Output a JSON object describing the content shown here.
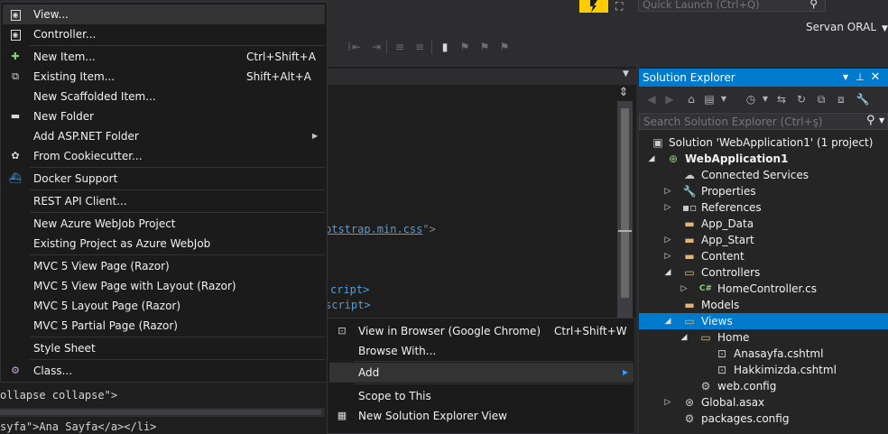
{
  "quick_launch": {
    "placeholder": "Quick Launch (Ctrl+Q)"
  },
  "user": {
    "name": "Servan ORAL"
  },
  "editor": {
    "code_fragments": {
      "css_link": "otstrap.min.css",
      "css_link_end": "\">",
      "script_close_1": "cript>",
      "script_close_2": "script>",
      "collapse": "ollapse collapse\">",
      "bottom_partial": "syfa\">Ana Sayfa</a></li>"
    }
  },
  "solution_explorer": {
    "title": "Solution Explorer",
    "search_placeholder": "Search Solution Explorer (Ctrl+ş)",
    "tree": [
      {
        "label": "Solution 'WebApplication1' (1 project)",
        "icon": "solution-icon"
      },
      {
        "label": "WebApplication1",
        "icon": "web-project-icon",
        "expanded": true
      },
      {
        "label": "Connected Services",
        "icon": "connected-services-icon"
      },
      {
        "label": "Properties",
        "icon": "wrench-icon"
      },
      {
        "label": "References",
        "icon": "references-icon"
      },
      {
        "label": "App_Data",
        "icon": "folder-icon"
      },
      {
        "label": "App_Start",
        "icon": "folder-icon"
      },
      {
        "label": "Content",
        "icon": "folder-icon"
      },
      {
        "label": "Controllers",
        "icon": "folder-icon",
        "expanded": true
      },
      {
        "label": "HomeController.cs",
        "icon": "csharp-file-icon"
      },
      {
        "label": "Models",
        "icon": "folder-icon"
      },
      {
        "label": "Views",
        "icon": "folder-icon",
        "expanded": true,
        "selected": true
      },
      {
        "label": "Home",
        "icon": "folder-open-icon",
        "expanded": true
      },
      {
        "label": "Anasayfa.cshtml",
        "icon": "razor-file-icon"
      },
      {
        "label": "Hakkimizda.cshtml",
        "icon": "razor-file-icon"
      },
      {
        "label": "web.config",
        "icon": "config-file-icon"
      },
      {
        "label": "Global.asax",
        "icon": "asax-file-icon"
      },
      {
        "label": "packages.config",
        "icon": "config-file-icon"
      }
    ]
  },
  "add_menu": {
    "items": [
      {
        "label": "View...",
        "shortcut": "",
        "icon": "view-icon",
        "highlighted": true
      },
      {
        "label": "Controller...",
        "shortcut": "",
        "icon": "controller-icon"
      },
      {
        "label": "New Item...",
        "shortcut": "Ctrl+Shift+A",
        "icon": "new-item-icon"
      },
      {
        "label": "Existing Item...",
        "shortcut": "Shift+Alt+A",
        "icon": "existing-item-icon"
      },
      {
        "label": "New Scaffolded Item...",
        "shortcut": "",
        "icon": ""
      },
      {
        "label": "New Folder",
        "shortcut": "",
        "icon": "new-folder-icon"
      },
      {
        "label": "Add ASP.NET Folder",
        "shortcut": "",
        "icon": "",
        "submenu": true
      },
      {
        "label": "From Cookiecutter...",
        "shortcut": "",
        "icon": "cookiecutter-icon"
      },
      {
        "label": "Docker Support",
        "shortcut": "",
        "icon": "docker-icon"
      },
      {
        "label": "REST API Client...",
        "shortcut": "",
        "icon": ""
      },
      {
        "label": "New Azure WebJob Project",
        "shortcut": "",
        "icon": ""
      },
      {
        "label": "Existing Project as Azure WebJob",
        "shortcut": "",
        "icon": ""
      },
      {
        "label": "MVC 5 View Page (Razor)",
        "shortcut": "",
        "icon": ""
      },
      {
        "label": "MVC 5 View Page with Layout (Razor)",
        "shortcut": "",
        "icon": ""
      },
      {
        "label": "MVC 5 Layout Page (Razor)",
        "shortcut": "",
        "icon": ""
      },
      {
        "label": "MVC 5 Partial Page (Razor)",
        "shortcut": "",
        "icon": ""
      },
      {
        "label": "Style Sheet",
        "shortcut": "",
        "icon": ""
      },
      {
        "label": "Class...",
        "shortcut": "",
        "icon": "class-icon"
      }
    ]
  },
  "context_menu": {
    "items": [
      {
        "label": "View in Browser (Google Chrome)",
        "shortcut": "Ctrl+Shift+W",
        "icon": "view-in-browser-icon"
      },
      {
        "label": "Browse With...",
        "shortcut": "",
        "icon": ""
      },
      {
        "label": "Add",
        "shortcut": "",
        "icon": "",
        "submenu": true,
        "highlighted": true
      },
      {
        "label": "Scope to This",
        "shortcut": "",
        "icon": ""
      },
      {
        "label": "New Solution Explorer View",
        "shortcut": "",
        "icon": "new-solution-explorer-view-icon"
      }
    ]
  },
  "colors": {
    "accent": "#007acc",
    "menu_background": "#1b1b1c",
    "menu_highlight": "#333334",
    "folder": "#dcb67a",
    "quick_launch_badge": "#ffcc00"
  }
}
